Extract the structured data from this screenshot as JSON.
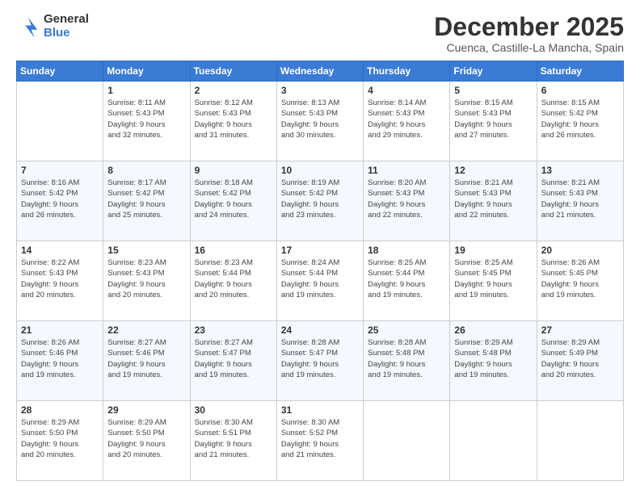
{
  "logo": {
    "general": "General",
    "blue": "Blue"
  },
  "title": "December 2025",
  "subtitle": "Cuenca, Castille-La Mancha, Spain",
  "days_of_week": [
    "Sunday",
    "Monday",
    "Tuesday",
    "Wednesday",
    "Thursday",
    "Friday",
    "Saturday"
  ],
  "weeks": [
    [
      {
        "day": "",
        "info": ""
      },
      {
        "day": "1",
        "info": "Sunrise: 8:11 AM\nSunset: 5:43 PM\nDaylight: 9 hours\nand 32 minutes."
      },
      {
        "day": "2",
        "info": "Sunrise: 8:12 AM\nSunset: 5:43 PM\nDaylight: 9 hours\nand 31 minutes."
      },
      {
        "day": "3",
        "info": "Sunrise: 8:13 AM\nSunset: 5:43 PM\nDaylight: 9 hours\nand 30 minutes."
      },
      {
        "day": "4",
        "info": "Sunrise: 8:14 AM\nSunset: 5:43 PM\nDaylight: 9 hours\nand 29 minutes."
      },
      {
        "day": "5",
        "info": "Sunrise: 8:15 AM\nSunset: 5:43 PM\nDaylight: 9 hours\nand 27 minutes."
      },
      {
        "day": "6",
        "info": "Sunrise: 8:15 AM\nSunset: 5:42 PM\nDaylight: 9 hours\nand 26 minutes."
      }
    ],
    [
      {
        "day": "7",
        "info": ""
      },
      {
        "day": "8",
        "info": "Sunrise: 8:17 AM\nSunset: 5:42 PM\nDaylight: 9 hours\nand 25 minutes."
      },
      {
        "day": "9",
        "info": "Sunrise: 8:18 AM\nSunset: 5:42 PM\nDaylight: 9 hours\nand 24 minutes."
      },
      {
        "day": "10",
        "info": "Sunrise: 8:19 AM\nSunset: 5:42 PM\nDaylight: 9 hours\nand 23 minutes."
      },
      {
        "day": "11",
        "info": "Sunrise: 8:20 AM\nSunset: 5:43 PM\nDaylight: 9 hours\nand 22 minutes."
      },
      {
        "day": "12",
        "info": "Sunrise: 8:21 AM\nSunset: 5:43 PM\nDaylight: 9 hours\nand 22 minutes."
      },
      {
        "day": "13",
        "info": "Sunrise: 8:21 AM\nSunset: 5:43 PM\nDaylight: 9 hours\nand 21 minutes."
      }
    ],
    [
      {
        "day": "14",
        "info": ""
      },
      {
        "day": "15",
        "info": "Sunrise: 8:23 AM\nSunset: 5:43 PM\nDaylight: 9 hours\nand 20 minutes."
      },
      {
        "day": "16",
        "info": "Sunrise: 8:23 AM\nSunset: 5:44 PM\nDaylight: 9 hours\nand 20 minutes."
      },
      {
        "day": "17",
        "info": "Sunrise: 8:24 AM\nSunset: 5:44 PM\nDaylight: 9 hours\nand 19 minutes."
      },
      {
        "day": "18",
        "info": "Sunrise: 8:25 AM\nSunset: 5:44 PM\nDaylight: 9 hours\nand 19 minutes."
      },
      {
        "day": "19",
        "info": "Sunrise: 8:25 AM\nSunset: 5:45 PM\nDaylight: 9 hours\nand 19 minutes."
      },
      {
        "day": "20",
        "info": "Sunrise: 8:26 AM\nSunset: 5:45 PM\nDaylight: 9 hours\nand 19 minutes."
      }
    ],
    [
      {
        "day": "21",
        "info": ""
      },
      {
        "day": "22",
        "info": "Sunrise: 8:27 AM\nSunset: 5:46 PM\nDaylight: 9 hours\nand 19 minutes."
      },
      {
        "day": "23",
        "info": "Sunrise: 8:27 AM\nSunset: 5:47 PM\nDaylight: 9 hours\nand 19 minutes."
      },
      {
        "day": "24",
        "info": "Sunrise: 8:28 AM\nSunset: 5:47 PM\nDaylight: 9 hours\nand 19 minutes."
      },
      {
        "day": "25",
        "info": "Sunrise: 8:28 AM\nSunset: 5:48 PM\nDaylight: 9 hours\nand 19 minutes."
      },
      {
        "day": "26",
        "info": "Sunrise: 8:29 AM\nSunset: 5:48 PM\nDaylight: 9 hours\nand 19 minutes."
      },
      {
        "day": "27",
        "info": "Sunrise: 8:29 AM\nSunset: 5:49 PM\nDaylight: 9 hours\nand 20 minutes."
      }
    ],
    [
      {
        "day": "28",
        "info": "Sunrise: 8:29 AM\nSunset: 5:50 PM\nDaylight: 9 hours\nand 20 minutes."
      },
      {
        "day": "29",
        "info": "Sunrise: 8:29 AM\nSunset: 5:50 PM\nDaylight: 9 hours\nand 20 minutes."
      },
      {
        "day": "30",
        "info": "Sunrise: 8:30 AM\nSunset: 5:51 PM\nDaylight: 9 hours\nand 21 minutes."
      },
      {
        "day": "31",
        "info": "Sunrise: 8:30 AM\nSunset: 5:52 PM\nDaylight: 9 hours\nand 21 minutes."
      },
      {
        "day": "",
        "info": ""
      },
      {
        "day": "",
        "info": ""
      },
      {
        "day": "",
        "info": ""
      }
    ]
  ],
  "week1_sunday_info": "Sunrise: 8:16 AM\nSunset: 5:42 PM\nDaylight: 9 hours\nand 26 minutes.",
  "week3_sunday_info": "Sunrise: 8:22 AM\nSunset: 5:43 PM\nDaylight: 9 hours\nand 20 minutes.",
  "week4_sunday_info": "Sunrise: 8:26 AM\nSunset: 5:46 PM\nDaylight: 9 hours\nand 19 minutes."
}
